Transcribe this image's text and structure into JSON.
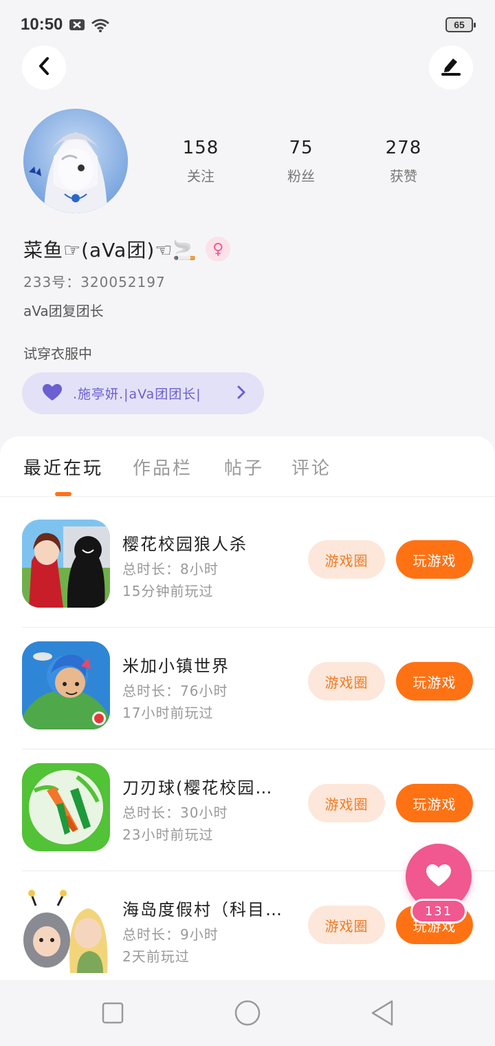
{
  "status_bar": {
    "time": "10:50",
    "battery": "65"
  },
  "header": {
    "back_icon": "back-arrow-icon",
    "edit_icon": "edit-pen-icon"
  },
  "profile": {
    "stats": [
      {
        "value": "158",
        "label": "关注"
      },
      {
        "value": "75",
        "label": "粉丝"
      },
      {
        "value": "278",
        "label": "获赞"
      }
    ],
    "username": "菜鱼☞(aVa团)☜🚬",
    "gender_symbol": "♀",
    "uid": "233号：320052197",
    "bio_line1": "aVa团复团长",
    "bio_line2": "试穿衣服中",
    "guild": {
      "text": ".施亭妍.|aVa团团长|",
      "icon": "heart-icon"
    }
  },
  "tabs": [
    {
      "label": "最近在玩",
      "active": true
    },
    {
      "label": "作品栏",
      "active": false
    },
    {
      "label": "帖子",
      "active": false
    },
    {
      "label": "评论",
      "active": false
    }
  ],
  "games": [
    {
      "title": "樱花校园狼人杀",
      "duration": "总时长：8小时",
      "last_played": "15分钟前玩过",
      "circle_label": "游戏圈",
      "play_label": "玩游戏"
    },
    {
      "title": "米加小镇世界",
      "duration": "总时长：76小时",
      "last_played": "17小时前玩过",
      "circle_label": "游戏圈",
      "play_label": "玩游戏"
    },
    {
      "title": "刀刃球(樱花校园…",
      "duration": "总时长：30小时",
      "last_played": "23小时前玩过",
      "circle_label": "游戏圈",
      "play_label": "玩游戏"
    },
    {
      "title": "海岛度假村（科目…",
      "duration": "总时长：9小时",
      "last_played": "2天前玩过",
      "circle_label": "游戏圈",
      "play_label": "玩游戏"
    }
  ],
  "like_fab": {
    "count": "131"
  },
  "colors": {
    "accent": "#ff7214",
    "pink": "#f0588f",
    "guild_bg": "#e3e1f7",
    "guild_text": "#6b5fd1"
  }
}
